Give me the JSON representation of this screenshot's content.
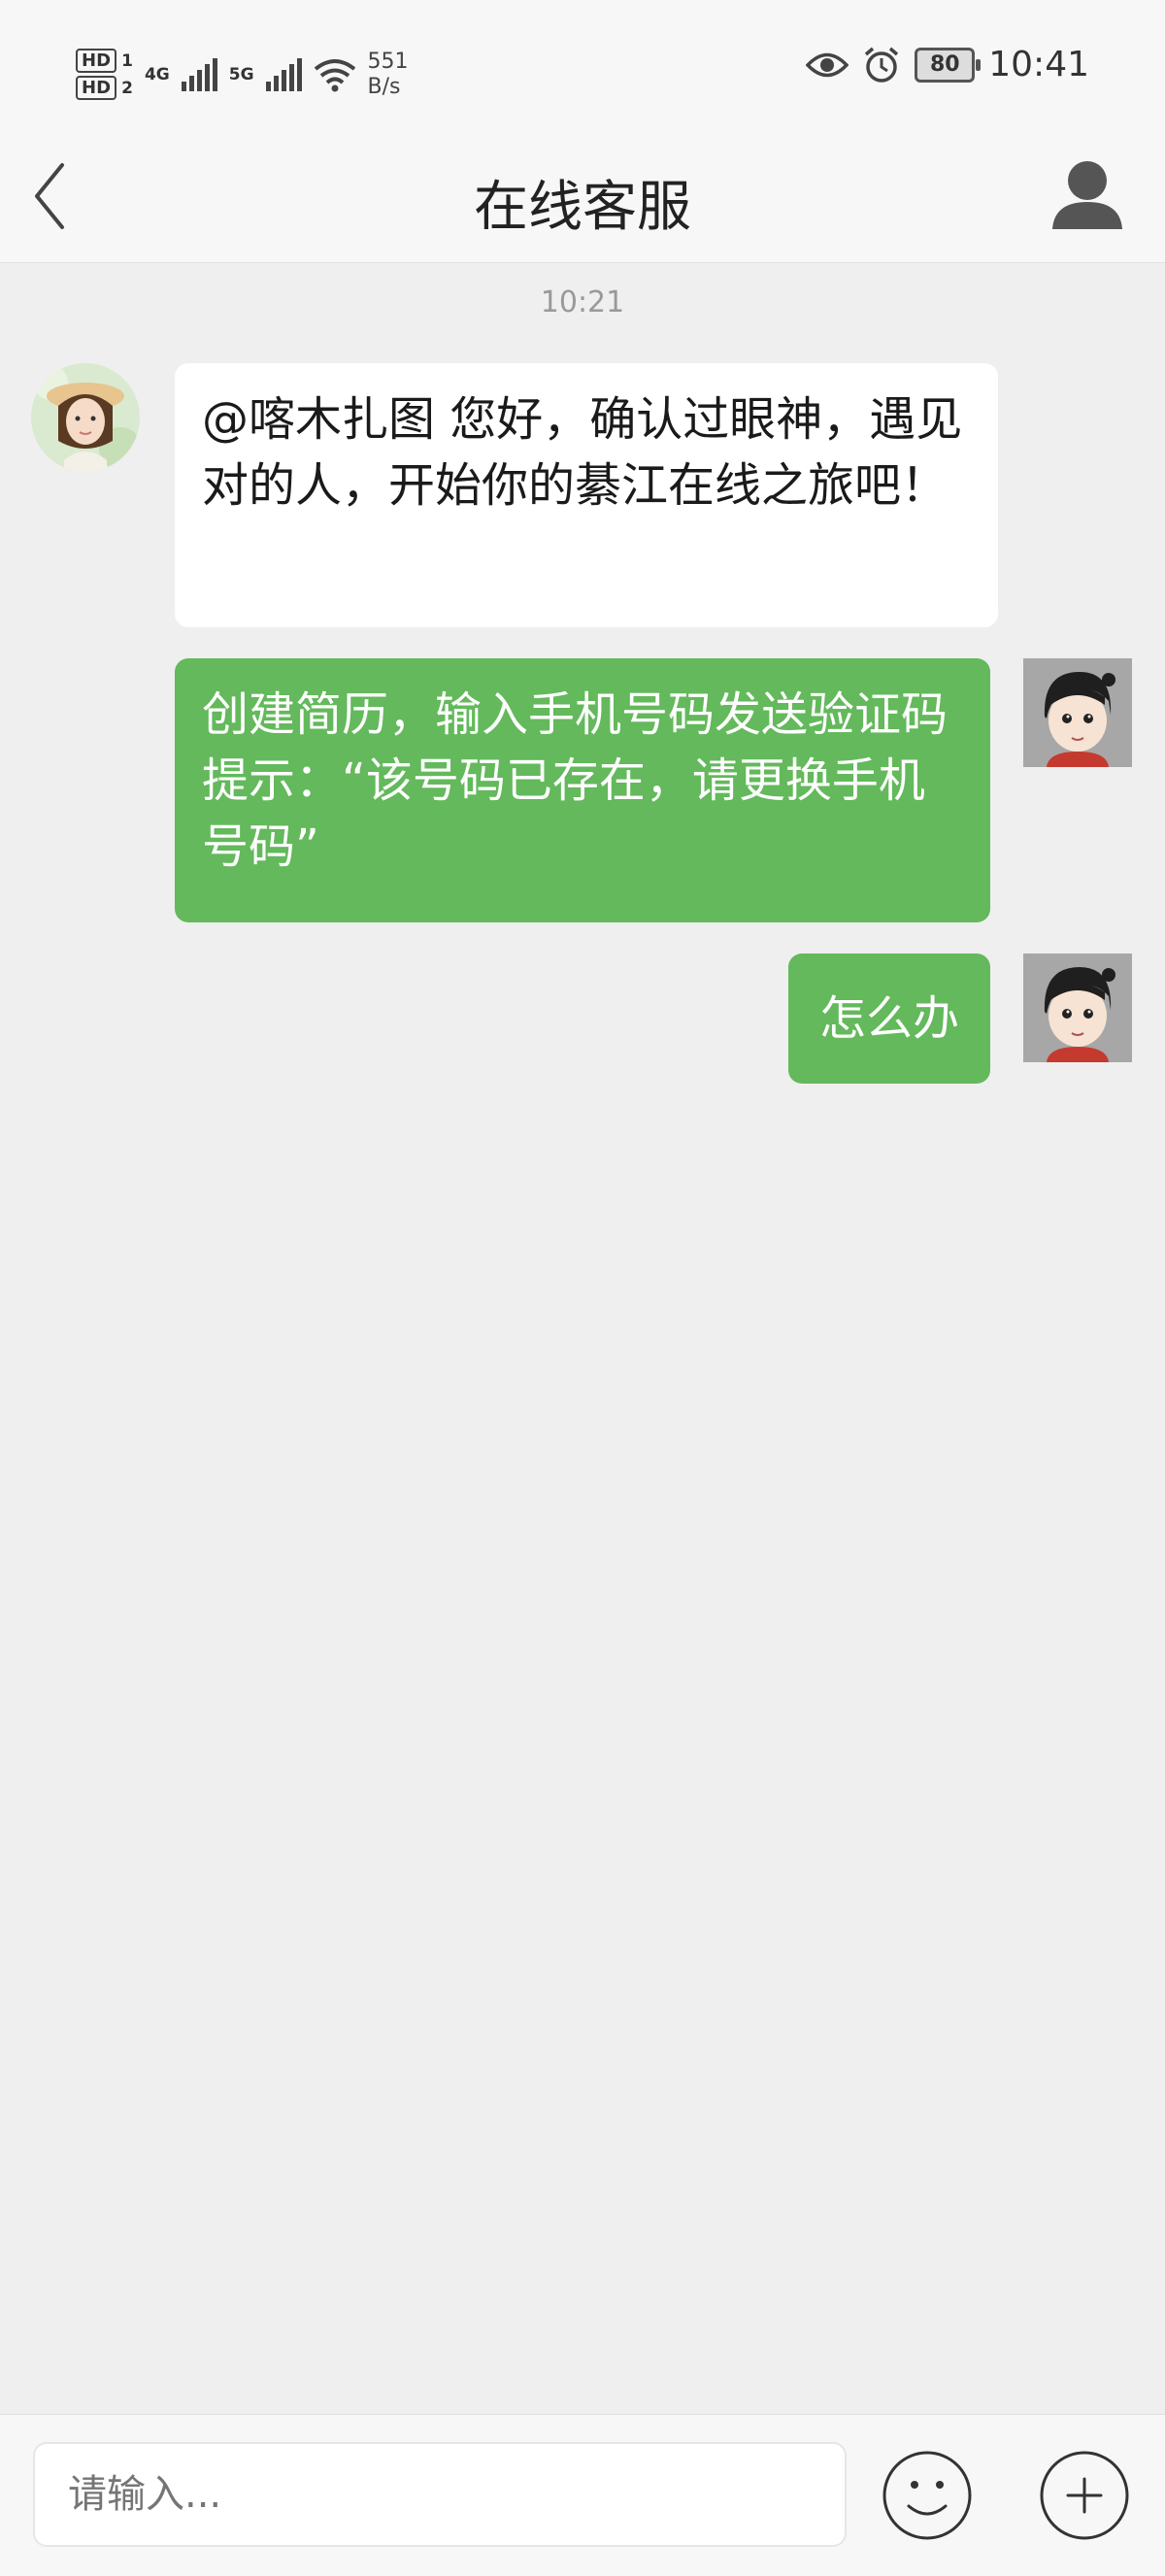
{
  "status_bar": {
    "hd1": "HD",
    "hd1_sub": "1",
    "hd2": "HD",
    "hd2_sub": "2",
    "net1": "4G",
    "net2": "5G",
    "speed_value": "551",
    "speed_unit": "B/s",
    "battery": "80",
    "time": "10:41"
  },
  "header": {
    "title": "在线客服"
  },
  "chat": {
    "timestamp": "10:21",
    "messages": [
      {
        "sender": "service",
        "text": "@喀木扎图 您好，确认过眼神，遇见对的人，开始你的綦江在线之旅吧！"
      },
      {
        "sender": "me",
        "text": "创建简历，输入手机号码发送验证码提示：“该号码已存在，请更换手机号码”"
      },
      {
        "sender": "me",
        "text": "怎么办"
      }
    ]
  },
  "composer": {
    "placeholder": "请输入..."
  },
  "colors": {
    "outgoing_bubble": "#63b95b",
    "incoming_bubble": "#ffffff",
    "background": "#efefef"
  },
  "icons": {
    "back": "chevron-left-icon",
    "user": "user-icon",
    "emoji": "emoji-icon",
    "plus": "plus-icon",
    "eye": "eye-icon",
    "alarm": "alarm-icon",
    "wifi": "wifi-icon"
  }
}
